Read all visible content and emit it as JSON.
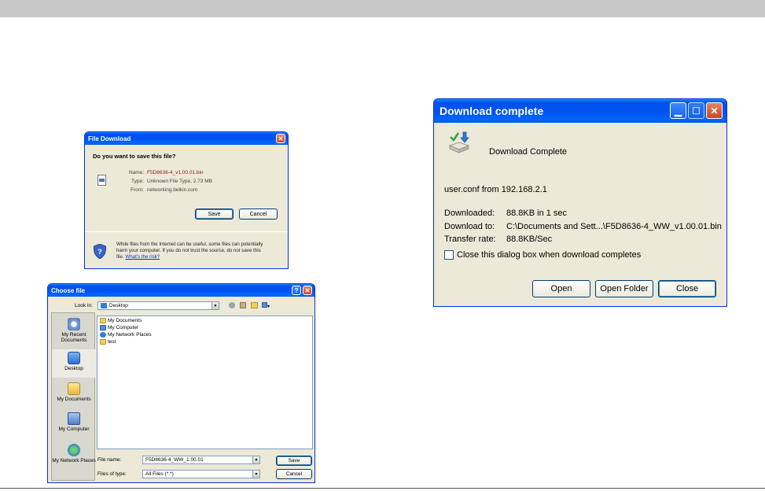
{
  "file_download": {
    "title": "File Download",
    "close_label": "✕",
    "question": "Do you want to save this file?",
    "name_label": "Name:",
    "name_value": "F5D8636-4_v1.00.01.bin",
    "type_label": "Type:",
    "type_value": "Unknown File Type, 2.73 MB",
    "from_label": "From:",
    "from_value": "networking.belkin.com",
    "save_label": "Save",
    "cancel_label": "Cancel",
    "warning_line1": "While files from the Internet can be useful, some files can potentially",
    "warning_line2": "harm your computer. If you do not trust the source, do not save this",
    "warning_line3": "file.",
    "risk_link": "What's the risk?"
  },
  "choose_file": {
    "title": "Choose file",
    "help_label": "?",
    "close_label": "✕",
    "look_in_label": "Look in:",
    "look_in_value": "Desktop",
    "places": [
      {
        "label": "My Recent Documents",
        "icon": "recent-documents-icon"
      },
      {
        "label": "Desktop",
        "icon": "desktop-icon"
      },
      {
        "label": "My Documents",
        "icon": "my-documents-icon"
      },
      {
        "label": "My Computer",
        "icon": "my-computer-icon"
      },
      {
        "label": "My Network Places",
        "icon": "network-places-icon"
      }
    ],
    "files": [
      "My Documents",
      "My Computer",
      "My Network Places",
      "test"
    ],
    "file_name_label": "File name:",
    "file_name_value": "F5D8636-4_WW_1.00.01",
    "file_type_label": "Files of type:",
    "file_type_value": "All Files (*.*)",
    "save_label": "Save",
    "cancel_label": "Cancel"
  },
  "download_complete": {
    "title": "Download complete",
    "heading": "Download Complete",
    "source": "user.conf from 192.168.2.1",
    "downloaded_label": "Downloaded:",
    "downloaded_value": "88.8KB in 1 sec",
    "download_to_label": "Download to:",
    "download_to_value": "C:\\Documents and Sett...\\F5D8636-4_WW_v1.00.01.bin",
    "transfer_rate_label": "Transfer rate:",
    "transfer_rate_value": "88.8KB/Sec",
    "checkbox_label": "Close this dialog box when download completes",
    "checkbox_checked": false,
    "open_label": "Open",
    "open_folder_label": "Open Folder",
    "close_label": "Close"
  }
}
